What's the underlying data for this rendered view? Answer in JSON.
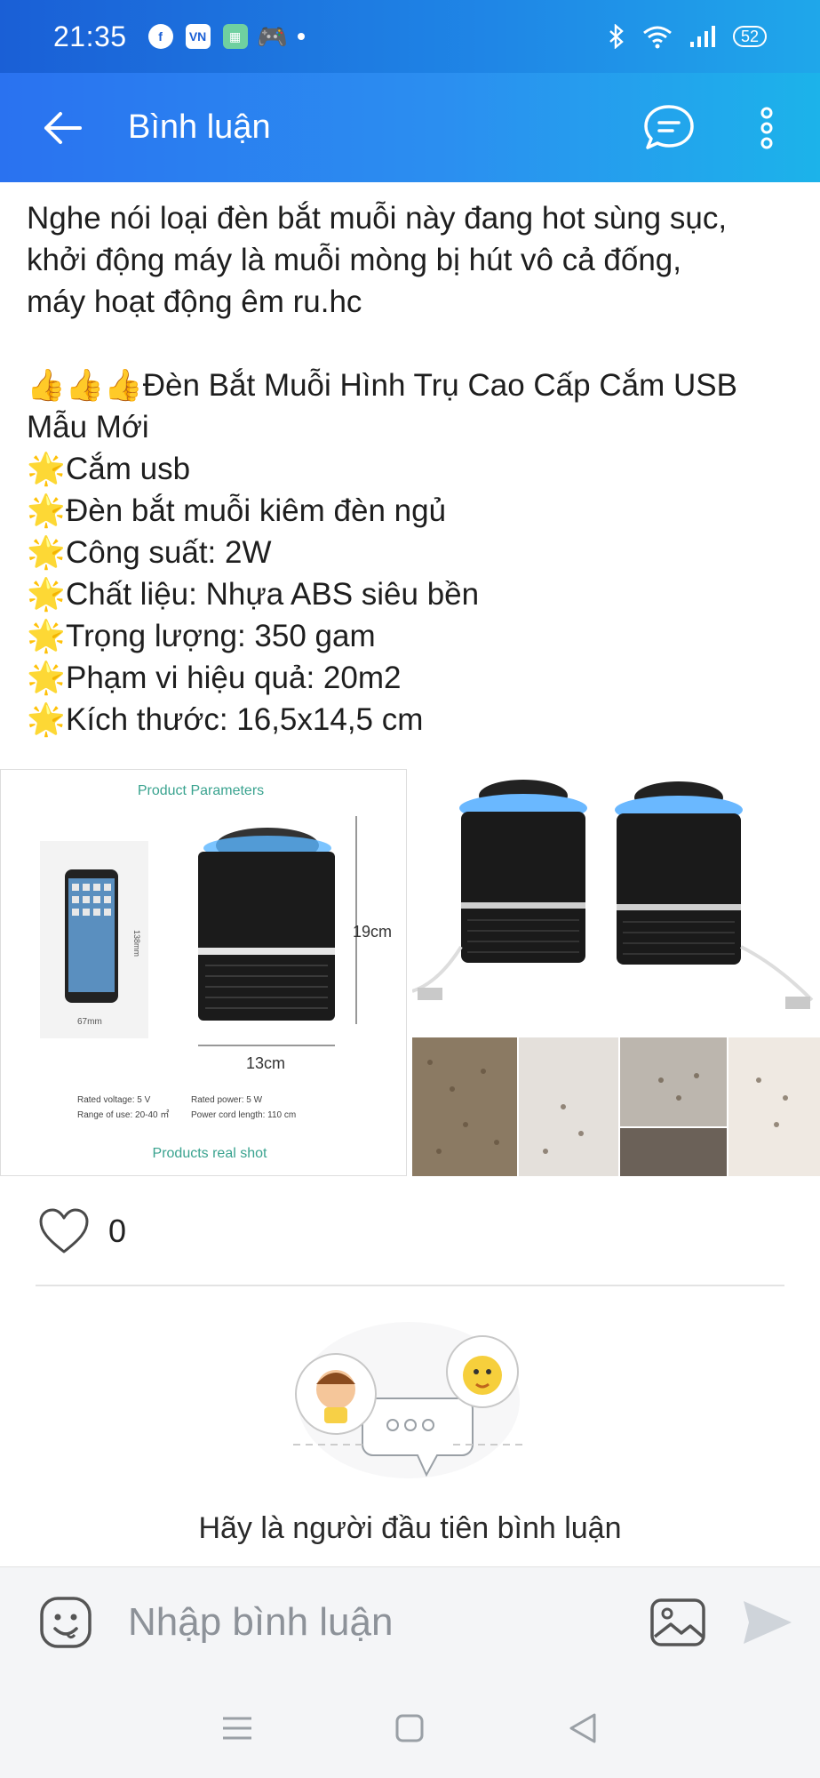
{
  "status": {
    "time": "21:35",
    "battery": "52"
  },
  "header": {
    "title": "Bình luận"
  },
  "post": {
    "intro_lines": [
      "Nghe nói loại đèn bắt muỗi này đang hot sùng sục,",
      "khởi động máy là muỗi mòng bị hút vô cả đống,",
      "máy hoạt động êm ru.hc"
    ],
    "headline_emoji": "👍👍👍",
    "headline": "Đèn Bắt Muỗi Hình Trụ Cao Cấp Cắm USB",
    "headline_cont": "Mẫu Mới",
    "star": "🌟",
    "features": [
      "Cắm usb",
      "Đèn bắt muỗi kiêm đèn ngủ",
      "Công suất: 2W",
      "Chất liệu: Nhựa ABS siêu bền",
      "Trọng lượng: 350 gam",
      "Phạm vi hiệu quả: 20m2",
      "Kích thước: 16,5x14,5 cm"
    ]
  },
  "product_image": {
    "title": "Product  Parameters",
    "phone_height": "138mm",
    "phone_width": "67mm",
    "height": "19cm",
    "width": "13cm",
    "rated_voltage": "Rated voltage:  5 V",
    "rated_power": "Rated power:  5 W",
    "range": "Range of use: 20-40 ㎡",
    "cord": "Power cord length: 110 cm",
    "footer": "Products real shot"
  },
  "likes": {
    "count": "0"
  },
  "empty_state": {
    "text": "Hãy là người đầu tiên bình luận"
  },
  "comment_bar": {
    "placeholder": "Nhập bình luận"
  }
}
